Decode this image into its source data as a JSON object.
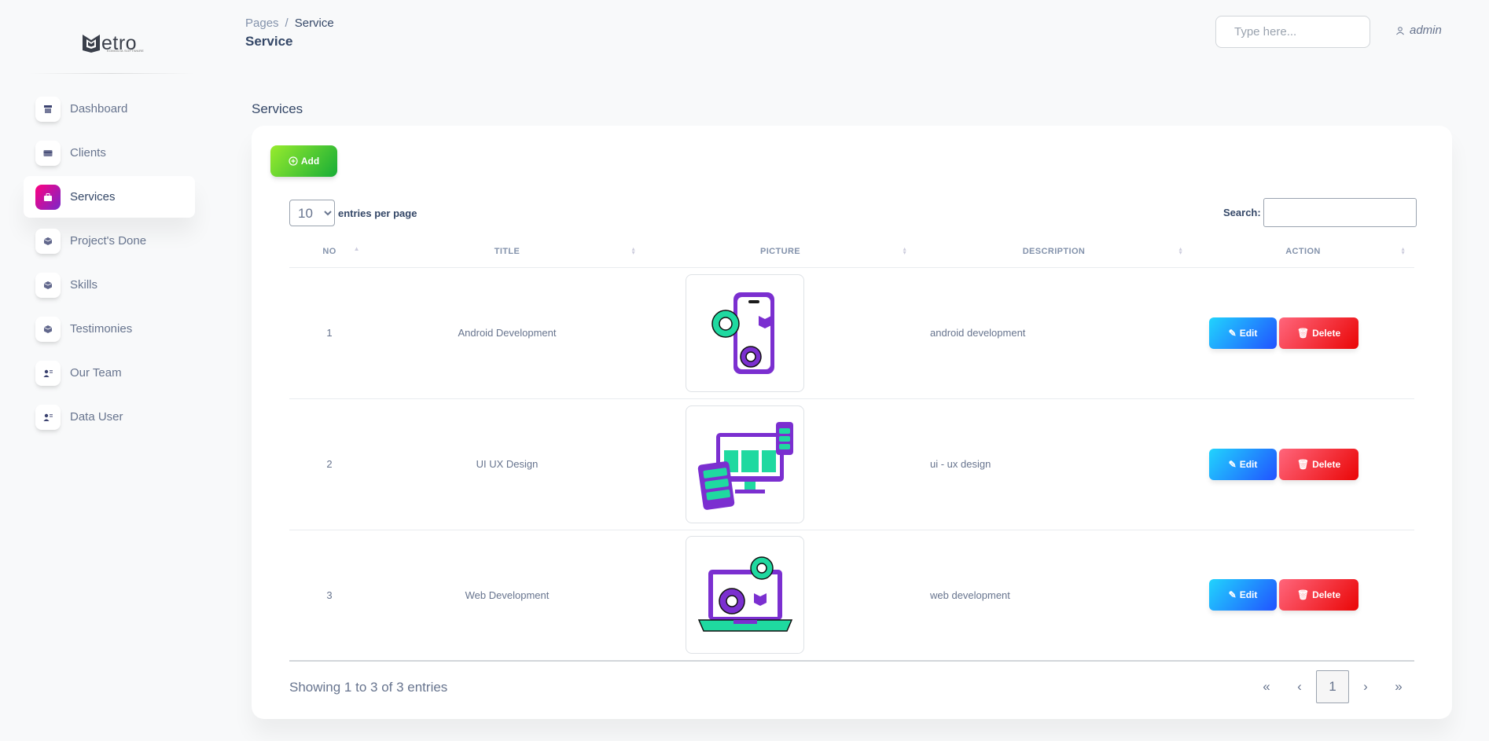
{
  "brand": {
    "name": "etro",
    "tagline": "KOMODIA SOFTWARE"
  },
  "sidebar": {
    "items": [
      {
        "label": "Dashboard",
        "icon": "shop-icon",
        "active": false
      },
      {
        "label": "Clients",
        "icon": "credit-card-icon",
        "active": false
      },
      {
        "label": "Services",
        "icon": "briefcase-icon",
        "active": true
      },
      {
        "label": "Project's Done",
        "icon": "box-icon",
        "active": false
      },
      {
        "label": "Skills",
        "icon": "box-icon",
        "active": false
      },
      {
        "label": "Testimonies",
        "icon": "box-icon",
        "active": false
      },
      {
        "label": "Our Team",
        "icon": "users-icon",
        "active": false
      },
      {
        "label": "Data User",
        "icon": "users-icon",
        "active": false
      }
    ]
  },
  "navbar": {
    "breadcrumb_root": "Pages",
    "breadcrumb_sep": "/",
    "breadcrumb_current": "Service",
    "title": "Service",
    "search_placeholder": "Type here...",
    "user": "admin"
  },
  "main": {
    "section_title": "Services",
    "add_label": "Add",
    "entries_value": "10",
    "entries_options": [
      "10"
    ],
    "entries_label": "entries per page",
    "search_label": "Search:",
    "columns": [
      "No",
      "Title",
      "Picture",
      "Description",
      "Action"
    ],
    "rows": [
      {
        "no": "1",
        "title": "Android Development",
        "picture": "android-development-illustration",
        "description": "android development"
      },
      {
        "no": "2",
        "title": "UI UX Design",
        "picture": "ui-ux-design-illustration",
        "description": "ui - ux design"
      },
      {
        "no": "3",
        "title": "Web Development",
        "picture": "web-development-illustration",
        "description": "web development"
      }
    ],
    "edit_label": "Edit",
    "delete_label": "Delete",
    "footer_info": "Showing 1 to 3 of 3 entries",
    "pagination": {
      "first": "«",
      "prev": "‹",
      "current": "1",
      "next": "›",
      "last": "»"
    }
  },
  "colors": {
    "accent_gradient_start": "#7928ca",
    "accent_gradient_end": "#ff0080",
    "add_green": "#17ad37",
    "edit_blue": "#2152ff",
    "delete_red": "#ea0606",
    "illustration_purple": "#7b2fd0",
    "illustration_green": "#1fd9a0"
  }
}
